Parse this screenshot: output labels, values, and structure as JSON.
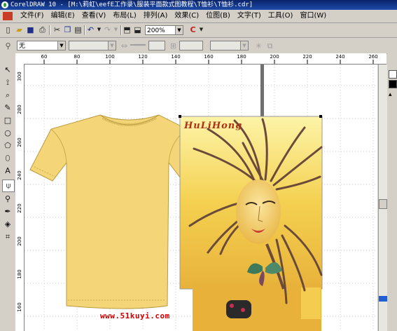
{
  "window": {
    "title": "CorelDRAW 10 - [M:\\莉虹\\eefE工作录\\服装平面款式图教程\\T恤衫\\T恤衫.cdr]"
  },
  "menu": [
    {
      "label": "文件(F)"
    },
    {
      "label": "编辑(E)"
    },
    {
      "label": "查看(V)"
    },
    {
      "label": "布局(L)"
    },
    {
      "label": "排列(A)"
    },
    {
      "label": "效果(C)"
    },
    {
      "label": "位图(B)"
    },
    {
      "label": "文字(T)"
    },
    {
      "label": "工具(O)"
    },
    {
      "label": "窗口(W)"
    }
  ],
  "toolbar": {
    "zoom_value": "200%"
  },
  "property_bar": {
    "fill_value": "无"
  },
  "ruler": {
    "h_ticks": [
      "60",
      "80",
      "100",
      "120",
      "140",
      "160",
      "180",
      "200",
      "220",
      "240",
      "260"
    ],
    "v_ticks": [
      "300",
      "280",
      "260",
      "240",
      "220",
      "200",
      "180",
      "160"
    ]
  },
  "artwork": {
    "caption": "HuLiHong",
    "watermark": "www.51kuyi.com"
  },
  "colors": {
    "titlebar": "#0a246a",
    "shirt": "#f4d678",
    "poster_top": "#fdf4a8",
    "poster_bottom": "#e8b23a",
    "hair": "#6b4a3a"
  },
  "palette": [
    "#ffffff",
    "#000000",
    "#2030c8",
    "#d4d0c8"
  ]
}
